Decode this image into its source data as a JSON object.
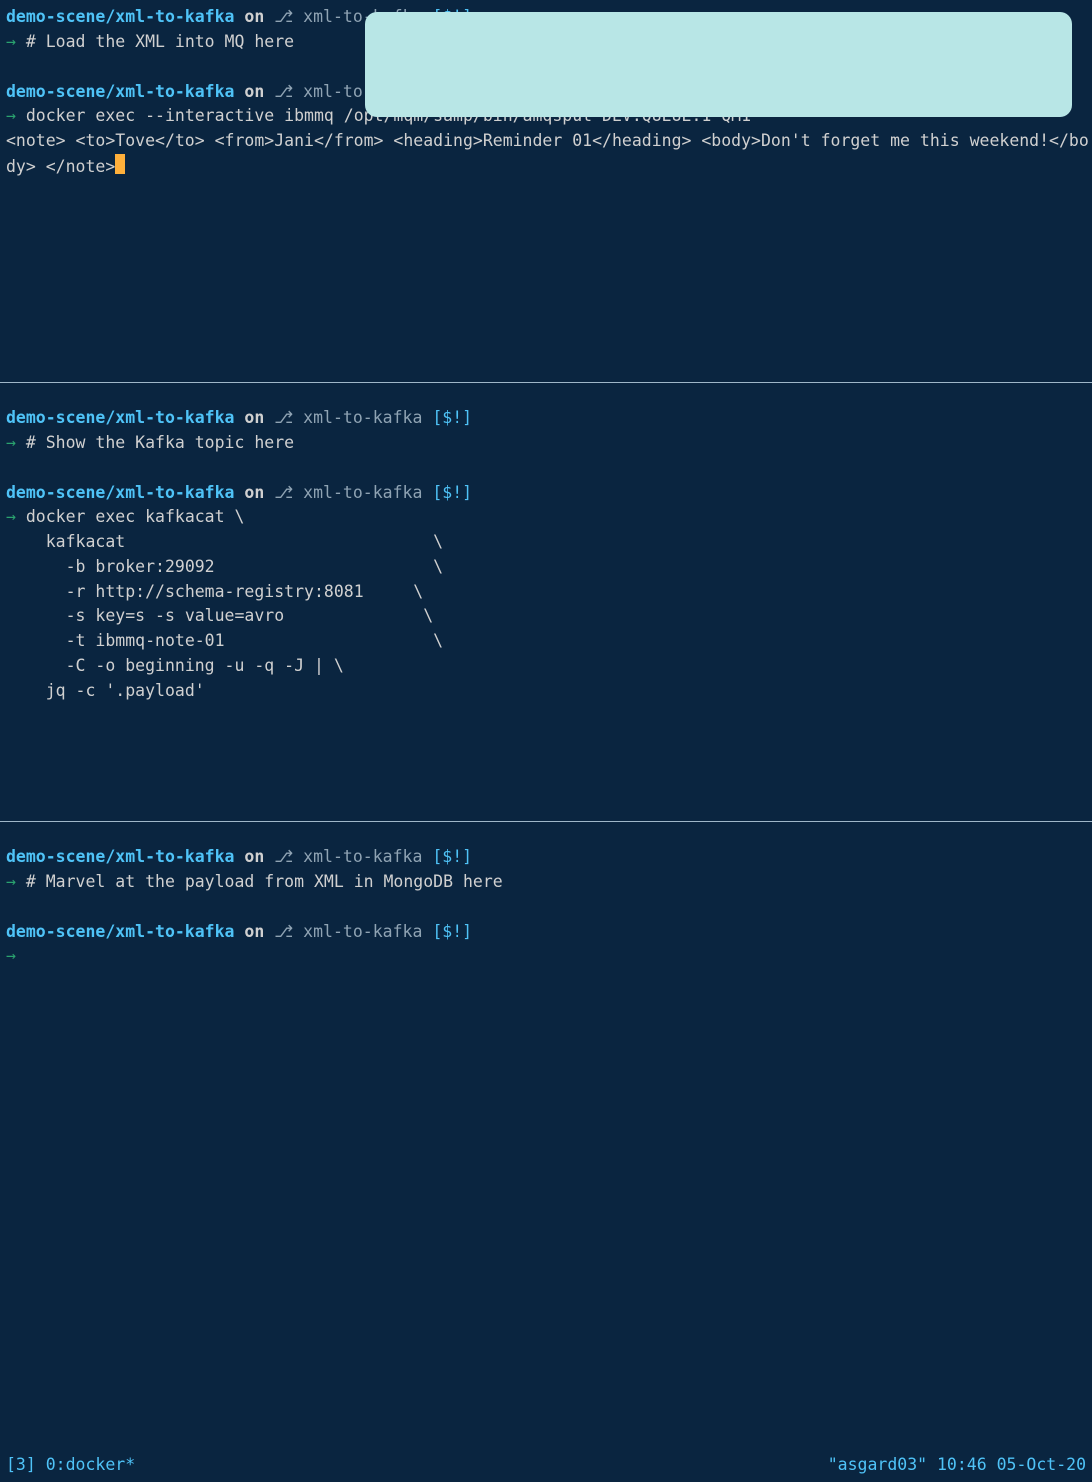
{
  "prompt": {
    "path": "demo-scene/xml-to-kafka",
    "on": " on ",
    "branch_icon": "⎇",
    "branch": " xml-to-kafka ",
    "flags": "[$!]",
    "arrow": "→ "
  },
  "pane1": {
    "comment": "# Load the XML into MQ here",
    "cmd": "docker exec --interactive ibmmq /opt/mqm/samp/bin/amqsput DEV.QUEUE.1 QM1",
    "payload": "<note> <to>Tove</to> <from>Jani</from> <heading>Reminder 01</heading> <body>Don't forget me this weekend!</body> </note>"
  },
  "pane2": {
    "comment": "# Show the Kafka topic here",
    "cmd_lines": [
      "docker exec kafkacat \\",
      "    kafkacat                               \\",
      "      -b broker:29092                      \\",
      "      -r http://schema-registry:8081     \\",
      "      -s key=s -s value=avro              \\",
      "      -t ibmmq-note-01                     \\",
      "      -C -o beginning -u -q -J | \\",
      "    jq -c '.payload'"
    ]
  },
  "pane3": {
    "comment": "# Marvel at the payload from XML in MongoDB here"
  },
  "statusbar": {
    "left": "[3] 0:docker*",
    "right": "\"asgard03\" 10:46 05-Oct-20"
  }
}
